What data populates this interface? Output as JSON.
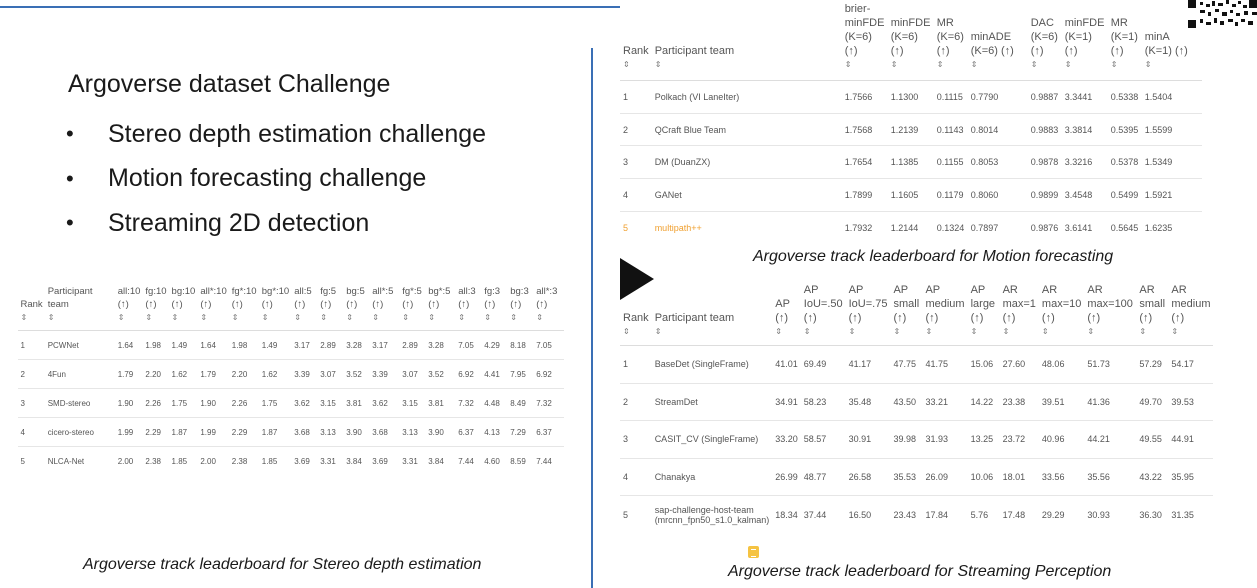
{
  "slide": {
    "title": "Argoverse dataset Challenge",
    "bullets": [
      "Stereo depth estimation challenge",
      "Motion forecasting challenge",
      "Streaming 2D detection"
    ],
    "bullet_glyph": "•"
  },
  "sort_glyph": "⇕",
  "stereo": {
    "caption": "Argoverse track leaderboard for Stereo depth estimation",
    "headers": [
      "Rank",
      "Participant team",
      "all:10 (↑)",
      "fg:10 (↑)",
      "bg:10 (↑)",
      "all*:10 (↑)",
      "fg*:10 (↑)",
      "bg*:10 (↑)",
      "all:5 (↑)",
      "fg:5 (↑)",
      "bg:5 (↑)",
      "all*:5 (↑)",
      "fg*:5 (↑)",
      "bg*:5 (↑)",
      "all:3 (↑)",
      "fg:3 (↑)",
      "bg:3 (↑)",
      "all*:3 (↑)"
    ],
    "rows": [
      [
        "1",
        "PCWNet",
        "1.64",
        "1.98",
        "1.49",
        "1.64",
        "1.98",
        "1.49",
        "3.17",
        "2.89",
        "3.28",
        "3.17",
        "2.89",
        "3.28",
        "7.05",
        "4.29",
        "8.18",
        "7.05"
      ],
      [
        "2",
        "4Fun",
        "1.79",
        "2.20",
        "1.62",
        "1.79",
        "2.20",
        "1.62",
        "3.39",
        "3.07",
        "3.52",
        "3.39",
        "3.07",
        "3.52",
        "6.92",
        "4.41",
        "7.95",
        "6.92"
      ],
      [
        "3",
        "SMD-stereo",
        "1.90",
        "2.26",
        "1.75",
        "1.90",
        "2.26",
        "1.75",
        "3.62",
        "3.15",
        "3.81",
        "3.62",
        "3.15",
        "3.81",
        "7.32",
        "4.48",
        "8.49",
        "7.32"
      ],
      [
        "4",
        "cicero-stereo",
        "1.99",
        "2.29",
        "1.87",
        "1.99",
        "2.29",
        "1.87",
        "3.68",
        "3.13",
        "3.90",
        "3.68",
        "3.13",
        "3.90",
        "6.37",
        "4.13",
        "7.29",
        "6.37"
      ],
      [
        "5",
        "NLCA-Net",
        "2.00",
        "2.38",
        "1.85",
        "2.00",
        "2.38",
        "1.85",
        "3.69",
        "3.31",
        "3.84",
        "3.69",
        "3.31",
        "3.84",
        "7.44",
        "4.60",
        "8.59",
        "7.44"
      ]
    ]
  },
  "motion": {
    "caption": "Argoverse track leaderboard for Motion forecasting",
    "headers": [
      "Rank",
      "Participant team",
      "brier-minFDE (K=6) (↑)",
      "minFDE (K=6) (↑)",
      "MR (K=6) (↑)",
      "minADE (K=6) (↑)",
      "DAC (K=6) (↑)",
      "minFDE (K=1) (↑)",
      "MR (K=1) (↑)",
      "minA (K=1) (↑)"
    ],
    "rows": [
      [
        "1",
        "Polkach (VI LaneIter)",
        "1.7566",
        "1.1300",
        "0.1115",
        "0.7790",
        "0.9887",
        "3.3441",
        "0.5338",
        "1.5404"
      ],
      [
        "2",
        "QCraft Blue Team",
        "1.7568",
        "1.2139",
        "0.1143",
        "0.8014",
        "0.9883",
        "3.3814",
        "0.5395",
        "1.5599"
      ],
      [
        "3",
        "DM (DuanZX)",
        "1.7654",
        "1.1385",
        "0.1155",
        "0.8053",
        "0.9878",
        "3.3216",
        "0.5378",
        "1.5349"
      ],
      [
        "4",
        "GANet",
        "1.7899",
        "1.1605",
        "0.1179",
        "0.8060",
        "0.9899",
        "3.4548",
        "0.5499",
        "1.5921"
      ],
      [
        "5",
        "multipath++",
        "1.7932",
        "1.2144",
        "0.1324",
        "0.7897",
        "0.9876",
        "3.6141",
        "0.5645",
        "1.6235"
      ]
    ],
    "highlight_color": "#f0a030"
  },
  "stream": {
    "caption": "Argoverse track leaderboard for Streaming Perception",
    "headers": [
      "Rank",
      "Participant team",
      "AP (↑)",
      "AP IoU=.50 (↑)",
      "AP IoU=.75 (↑)",
      "AP small (↑)",
      "AP medium (↑)",
      "AP large (↑)",
      "AR max=1 (↑)",
      "AR max=10 (↑)",
      "AR max=100 (↑)",
      "AR small (↑)",
      "AR medium (↑)"
    ],
    "rows": [
      [
        "1",
        "BaseDet (SingleFrame)",
        "41.01",
        "69.49",
        "41.17",
        "47.75",
        "41.75",
        "15.06",
        "27.60",
        "48.06",
        "51.73",
        "57.29",
        "54.17"
      ],
      [
        "2",
        "StreamDet",
        "34.91",
        "58.23",
        "35.48",
        "43.50",
        "33.21",
        "14.22",
        "23.38",
        "39.51",
        "41.36",
        "49.70",
        "39.53"
      ],
      [
        "3",
        "CASIT_CV (SingleFrame)",
        "33.20",
        "58.57",
        "30.91",
        "39.98",
        "31.93",
        "13.25",
        "23.72",
        "40.96",
        "44.21",
        "49.55",
        "44.91"
      ],
      [
        "4",
        "Chanakya",
        "26.99",
        "48.77",
        "26.58",
        "35.53",
        "26.09",
        "10.06",
        "18.01",
        "33.56",
        "35.56",
        "43.22",
        "35.95"
      ],
      [
        "5",
        "sap-challenge-host-team (mrcnn_fpn50_s1.0_kalman)",
        "18.34",
        "37.44",
        "16.50",
        "23.43",
        "17.84",
        "5.76",
        "17.48",
        "29.29",
        "30.93",
        "36.30",
        "31.35"
      ]
    ]
  },
  "icons": [
    "play-icon",
    "qr-code-icon",
    "badge-icon"
  ]
}
